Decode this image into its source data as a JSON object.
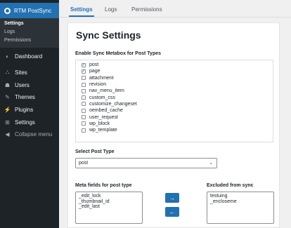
{
  "sidebar": {
    "plugin_title": "RTM PostSync",
    "submenu": [
      {
        "label": "Settings",
        "current": true
      },
      {
        "label": "Logs",
        "current": false
      },
      {
        "label": "Permissions",
        "current": false
      }
    ],
    "menu": [
      {
        "label": "Dashboard",
        "icon": "dashboard-icon",
        "glyph": "◐"
      },
      {
        "label": "Sites",
        "icon": "sites-icon",
        "glyph": "⛬"
      },
      {
        "label": "Users",
        "icon": "users-icon",
        "glyph": "☗"
      },
      {
        "label": "Themes",
        "icon": "themes-icon",
        "glyph": "✎"
      },
      {
        "label": "Plugins",
        "icon": "plugins-icon",
        "glyph": "⚡"
      },
      {
        "label": "Settings",
        "icon": "settings-icon",
        "glyph": "⊞"
      },
      {
        "label": "Collapse menu",
        "icon": "collapse-icon",
        "glyph": "◀"
      }
    ]
  },
  "tabs": [
    "Settings",
    "Logs",
    "Permissions"
  ],
  "active_tab": "Settings",
  "page": {
    "title": "Sync Settings",
    "metabox_label": "Enable Sync Metabox for Post Types",
    "post_types": [
      {
        "name": "post",
        "checked": true
      },
      {
        "name": "page",
        "checked": true
      },
      {
        "name": "attachment",
        "checked": false
      },
      {
        "name": "revision",
        "checked": false
      },
      {
        "name": "nav_menu_item",
        "checked": false
      },
      {
        "name": "custom_css",
        "checked": false
      },
      {
        "name": "customize_changeset",
        "checked": false
      },
      {
        "name": "oembed_cache",
        "checked": false
      },
      {
        "name": "user_request",
        "checked": false
      },
      {
        "name": "wp_block",
        "checked": false
      },
      {
        "name": "wp_template",
        "checked": false
      }
    ],
    "select_label": "Select Post Type",
    "selected_post_type": "post",
    "meta_label": "Meta fields for post type",
    "meta_fields": [
      "_edit_lock",
      "_thumbnail_id",
      "_edit_last"
    ],
    "excluded_label": "Excluded from sync",
    "excluded_fields": [
      "testuing",
      "_encloseme"
    ],
    "move_right": "→",
    "move_left": "←"
  },
  "colors": {
    "accent": "#2271b1",
    "sidebar": "#1d2327"
  }
}
